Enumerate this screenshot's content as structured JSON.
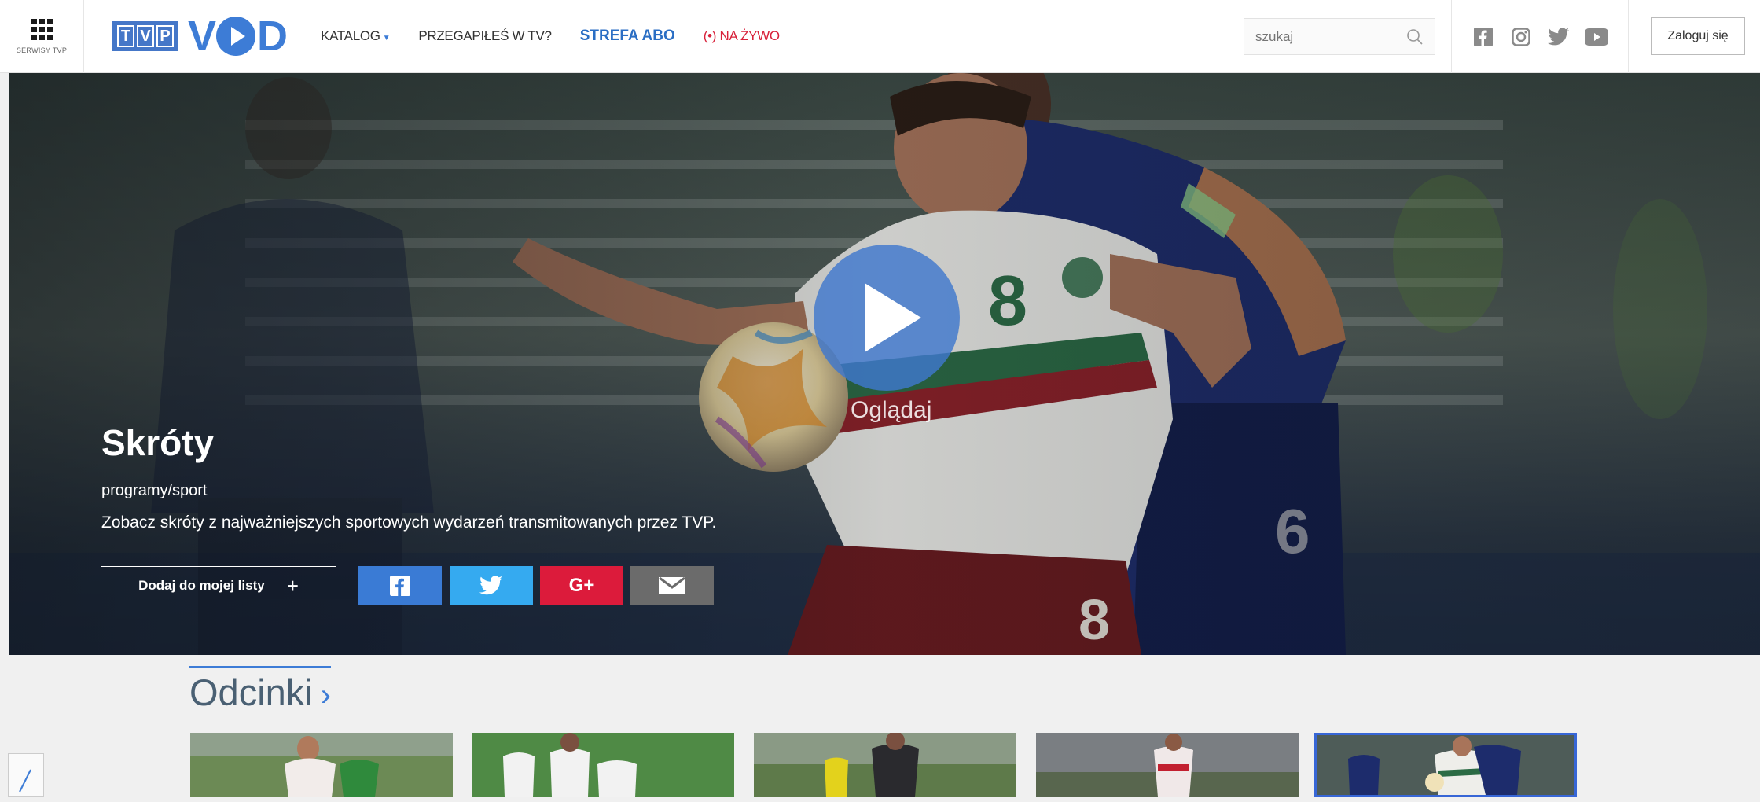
{
  "header": {
    "services_label": "SERWISY TVP",
    "logo_tvp_letters": [
      "T",
      "V",
      "P"
    ],
    "logo_vod_v": "V",
    "logo_vod_d": "D",
    "nav": {
      "katalog": "KATALOG",
      "przegapiles": "PRZEGAPIŁEŚ W TV?",
      "strefa_abo": "STREFA ABO",
      "live_signal": "(•)",
      "na_zywo": "NA ŻYWO"
    },
    "search_placeholder": "szukaj",
    "social_icons": [
      "facebook-icon",
      "instagram-icon",
      "twitter-icon",
      "youtube-icon"
    ],
    "login_label": "Zaloguj się"
  },
  "hero": {
    "title": "Skróty",
    "category": "programy/sport",
    "description": "Zobacz skróty z najważniejszych sportowych wydarzeń transmitowanych przez TVP.",
    "play_label": "Oglądaj",
    "add_to_list_label": "Dodaj do mojej listy",
    "add_to_list_plus": "+",
    "share_buttons": [
      {
        "name": "facebook",
        "glyph": "f",
        "color": "#3a7bd5"
      },
      {
        "name": "twitter",
        "glyph": "",
        "color": "#35aaf0"
      },
      {
        "name": "google-plus",
        "glyph": "G+",
        "color": "#dc1b3b"
      },
      {
        "name": "email",
        "glyph": "",
        "color": "#6b6b6b"
      }
    ]
  },
  "episodes": {
    "title": "Odcinki",
    "chevron": "›",
    "thumbnails": 5,
    "active_index": 4
  },
  "colors": {
    "brand_blue": "#3d7cd6",
    "live_red": "#d8213a",
    "abo_blue": "#2a6ec4"
  }
}
